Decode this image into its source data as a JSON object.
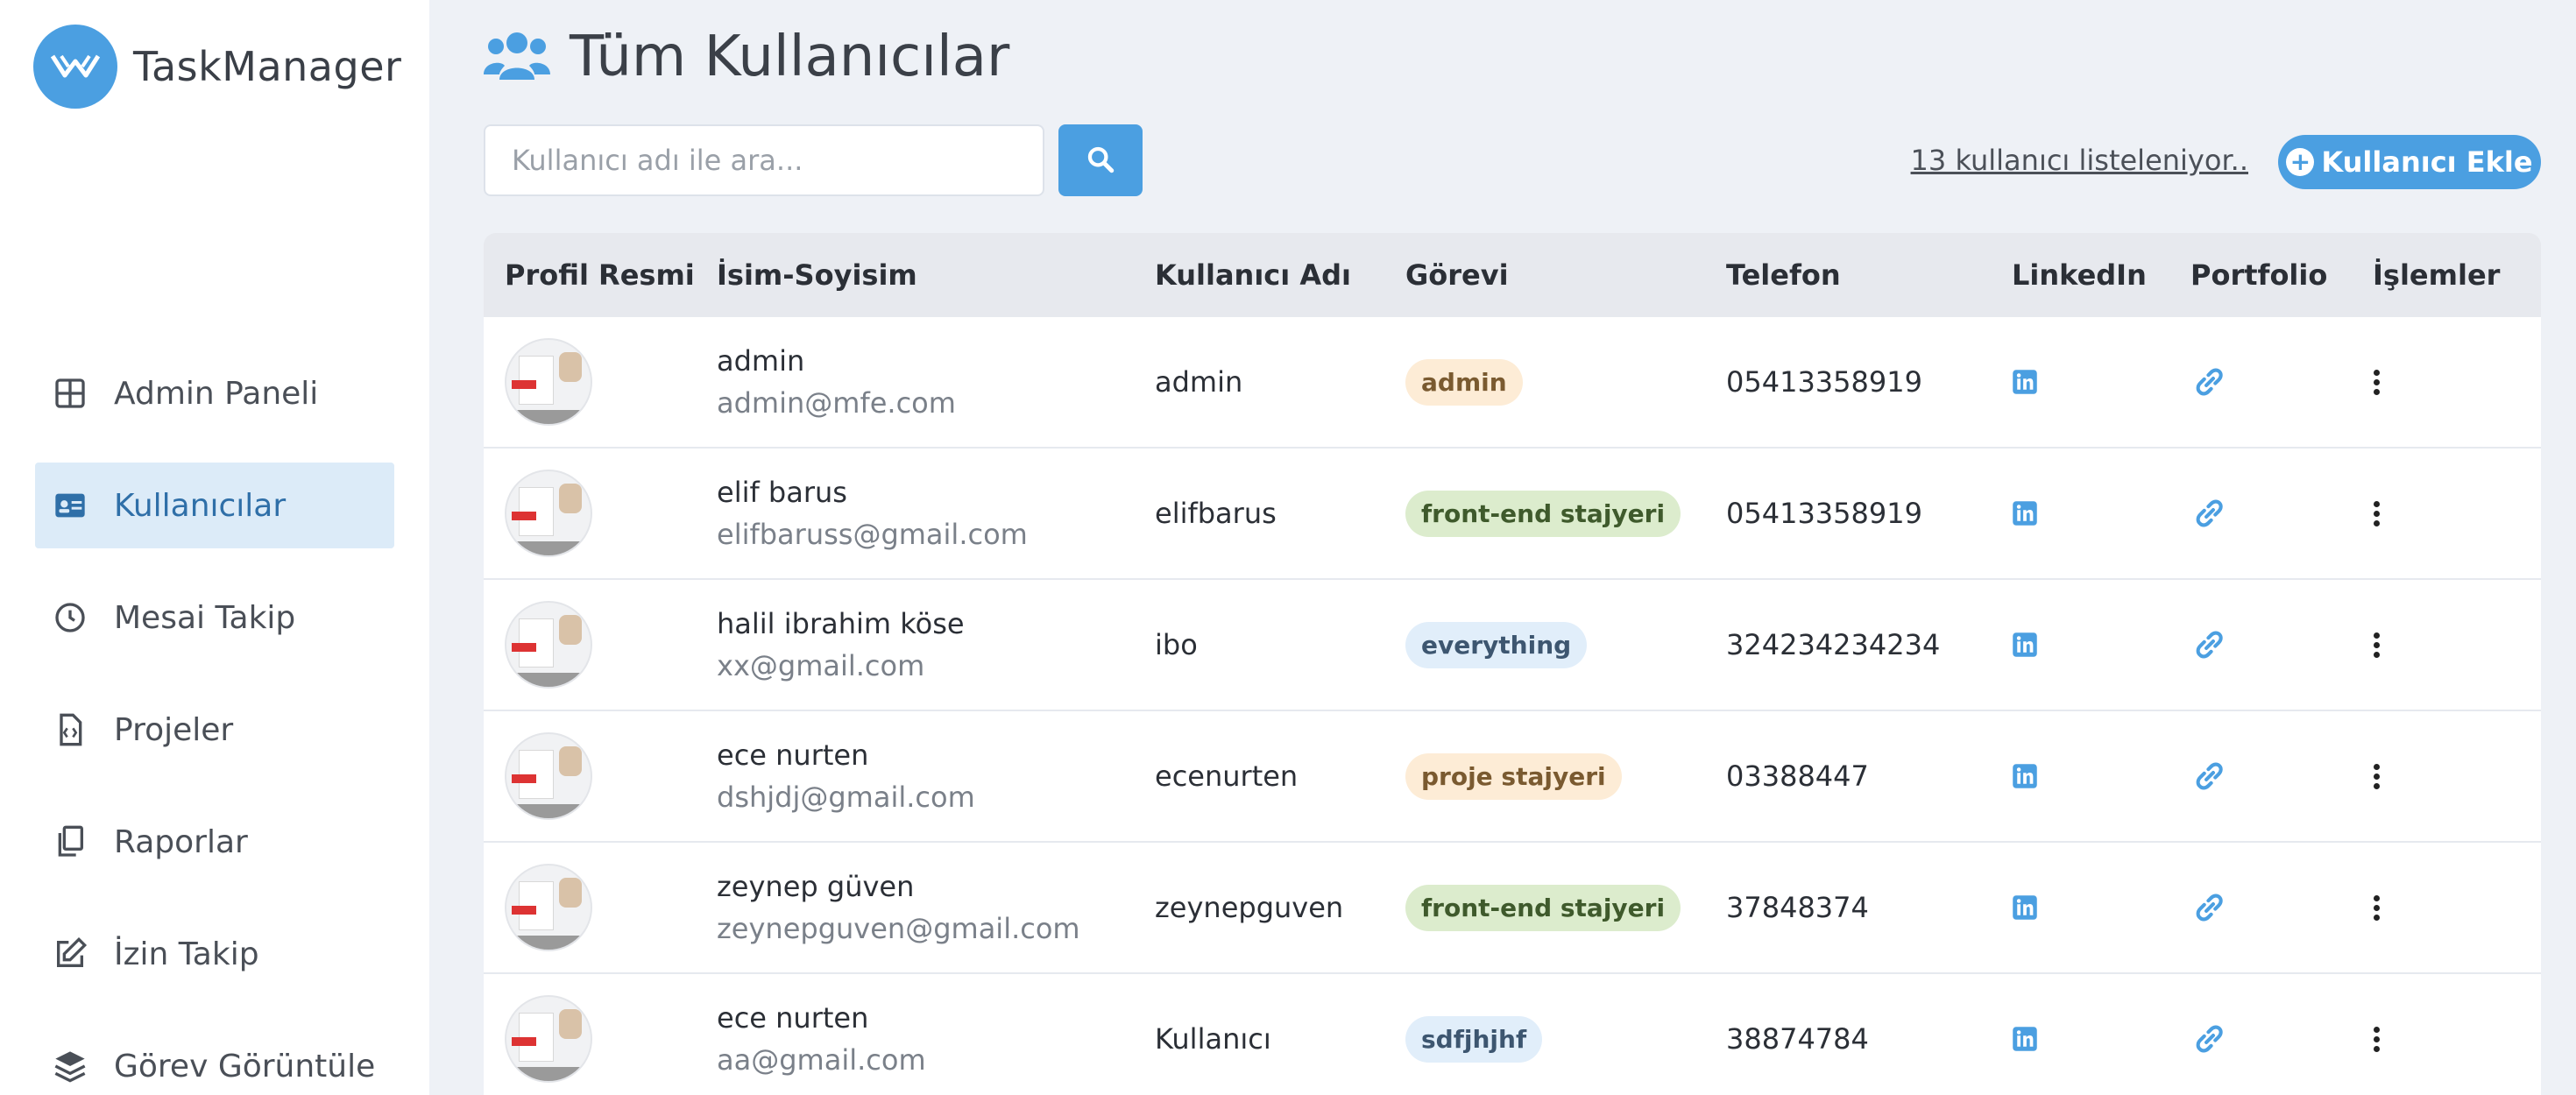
{
  "app": {
    "name": "TaskManager"
  },
  "sidebar": {
    "items": [
      {
        "label": "Admin Paneli",
        "icon": "grid-icon",
        "active": false
      },
      {
        "label": "Kullanıcılar",
        "icon": "id-card-icon",
        "active": true
      },
      {
        "label": "Mesai Takip",
        "icon": "clock-icon",
        "active": false
      },
      {
        "label": "Projeler",
        "icon": "code-file-icon",
        "active": false
      },
      {
        "label": "Raporlar",
        "icon": "copy-icon",
        "active": false
      },
      {
        "label": "İzin Takip",
        "icon": "edit-icon",
        "active": false
      },
      {
        "label": "Görev Görüntüle",
        "icon": "layers-icon",
        "active": false
      }
    ]
  },
  "page": {
    "title": "Tüm Kullanıcılar",
    "title_icon": "users-icon"
  },
  "search": {
    "placeholder": "Kullanıcı adı ile ara...",
    "value": "",
    "button_icon": "search-icon"
  },
  "toolbar": {
    "count_text": "13 kullanıcı listeleniyor..",
    "add_label": "Kullanıcı Ekle",
    "add_icon": "plus-circle-icon"
  },
  "table": {
    "headers": [
      "Profil Resmi",
      "İsim-Soyisim",
      "Kullanıcı Adı",
      "Görevi",
      "Telefon",
      "LinkedIn",
      "Portfolio",
      "İşlemler"
    ],
    "rows": [
      {
        "name": "admin",
        "email": "admin@mfe.com",
        "username": "admin",
        "role": "admin",
        "role_color": "orange",
        "phone": "05413358919"
      },
      {
        "name": "elif barus",
        "email": "elifbaruss@gmail.com",
        "username": "elifbarus",
        "role": "front-end stajyeri",
        "role_color": "green",
        "phone": "05413358919"
      },
      {
        "name": "halil ibrahim köse",
        "email": "xx@gmail.com",
        "username": "ibo",
        "role": "everything",
        "role_color": "blue",
        "phone": "324234234234"
      },
      {
        "name": "ece nurten",
        "email": "dshjdj@gmail.com",
        "username": "ecenurten",
        "role": "proje stajyeri",
        "role_color": "orange",
        "phone": "03388447"
      },
      {
        "name": "zeynep güven",
        "email": "zeynepguven@gmail.com",
        "username": "zeynepguven",
        "role": "front-end stajyeri",
        "role_color": "green",
        "phone": "37848374"
      },
      {
        "name": "ece nurten",
        "email": "aa@gmail.com",
        "username": "Kullanıcı",
        "role": "sdfjhjhf",
        "role_color": "blue",
        "phone": "38874784"
      }
    ]
  },
  "colors": {
    "accent": "#4b9fe1",
    "sidebar_active_bg": "#dcebf8",
    "page_bg": "#eef1f6"
  }
}
